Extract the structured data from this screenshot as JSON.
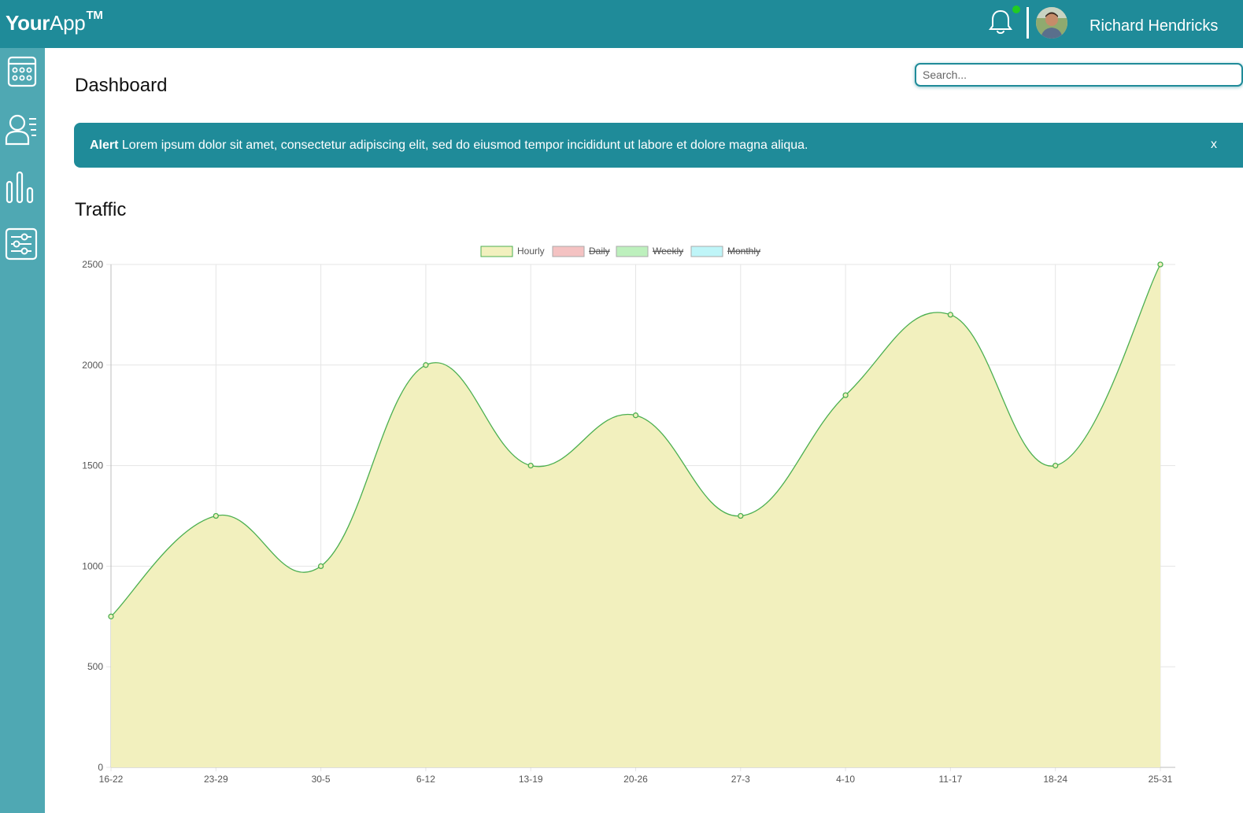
{
  "header": {
    "logo_bold": "Your",
    "logo_rest": "App",
    "logo_tm": "TM",
    "user_name": "Richard Hendricks",
    "icons": [
      "bell-icon",
      "avatar"
    ],
    "colors": {
      "header_bg": "#1f8b99",
      "sidebar_bg": "#4fa8b3",
      "notification_dot": "#22cc22"
    }
  },
  "sidebar": {
    "items": [
      {
        "icon": "calendar-icon"
      },
      {
        "icon": "users-icon"
      },
      {
        "icon": "bar-chart-icon"
      },
      {
        "icon": "settings-sliders-icon"
      }
    ]
  },
  "main": {
    "page_title": "Dashboard",
    "search_placeholder": "Search...",
    "alert": {
      "label": "Alert",
      "message": " Lorem ipsum dolor sit amet, consectetur adipiscing elit, sed do eiusmod tempor incididunt ut labore et dolore magna aliqua.",
      "close": "x"
    },
    "traffic_title": "Traffic"
  },
  "chart_data": {
    "type": "area",
    "categories": [
      "16-22",
      "23-29",
      "30-5",
      "6-12",
      "13-19",
      "20-26",
      "27-3",
      "4-10",
      "11-17",
      "18-24",
      "25-31"
    ],
    "series": [
      {
        "name": "Hourly",
        "values": [
          750,
          1250,
          1000,
          2000,
          1500,
          1750,
          1250,
          1850,
          2250,
          1500,
          2500
        ],
        "visible": true,
        "fill": "#f2f0be",
        "stroke": "#4caf50"
      },
      {
        "name": "Daily",
        "visible": false,
        "fill": "#f4c2c2"
      },
      {
        "name": "Weekly",
        "visible": false,
        "fill": "#bdf0bd"
      },
      {
        "name": "Monthly",
        "visible": false,
        "fill": "#bff5f8"
      }
    ],
    "yticks": [
      0,
      500,
      1000,
      1500,
      2000,
      2500
    ],
    "ylim": [
      0,
      2500
    ],
    "grid": true,
    "legend_position": "top-center"
  }
}
